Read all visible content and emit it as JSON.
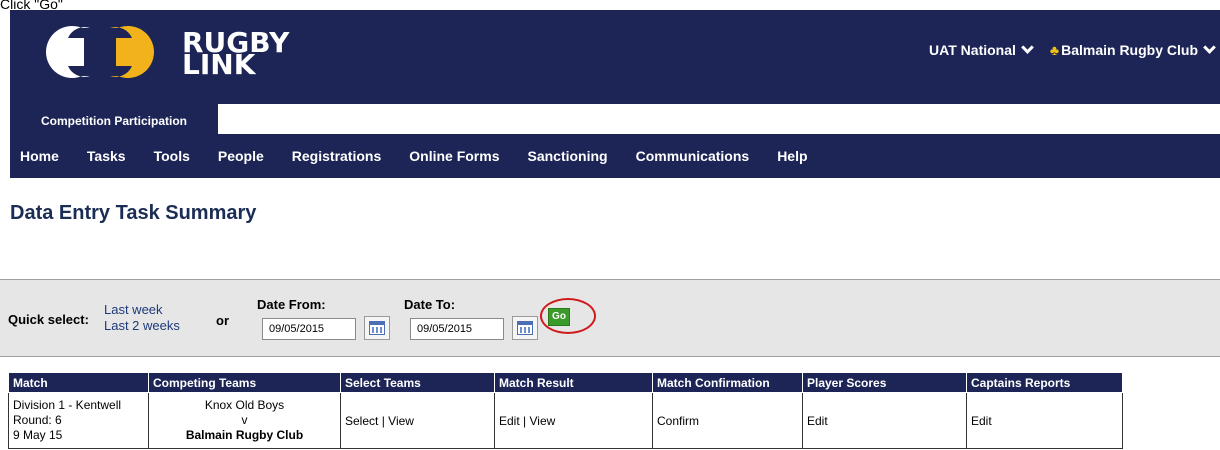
{
  "caption": "Click \"Go\"",
  "header": {
    "logo_text_line1": "RUGBY",
    "logo_text_line2": "LINK",
    "national": "UAT National",
    "club": "Balmain Rugby Club",
    "icon_org": "org-chart-icon",
    "brand_color": "#1c2556"
  },
  "tab": {
    "label": "Competition Participation"
  },
  "nav": [
    "Home",
    "Tasks",
    "Tools",
    "People",
    "Registrations",
    "Online Forms",
    "Sanctioning",
    "Communications",
    "Help"
  ],
  "page_title": "Data Entry Task Summary",
  "filter": {
    "quick_select_label": "Quick select:",
    "last_week": "Last week",
    "last_2_weeks": "Last 2 weeks",
    "or_label": "or",
    "date_from_label": "Date From:",
    "date_from_value": "09/05/2015",
    "date_to_label": "Date To:",
    "date_to_value": "09/05/2015",
    "go_label": "Go"
  },
  "table": {
    "headers": [
      "Match",
      "Competing Teams",
      "Select Teams",
      "Match Result",
      "Match Confirmation",
      "Player Scores",
      "Captains Reports"
    ],
    "rows": [
      {
        "match_division": "Division 1 - Kentwell",
        "match_round": "Round: 6",
        "match_date": "9 May 15",
        "team_away": "Knox Old Boys",
        "versus": "v",
        "team_home": "Balmain Rugby Club",
        "select": "Select",
        "view": "View",
        "result_edit": "Edit",
        "result_view": "View",
        "confirm": "Confirm",
        "player_scores": "Edit",
        "captains_reports": "Edit"
      }
    ]
  }
}
